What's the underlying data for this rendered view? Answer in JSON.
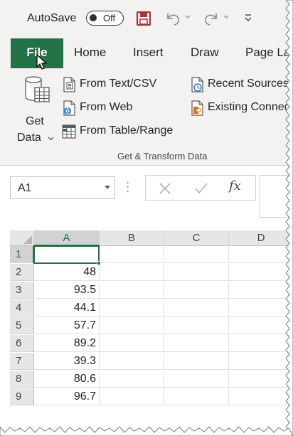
{
  "titlebar": {
    "autosave_label": "AutoSave",
    "autosave_state": "Off"
  },
  "tabs": [
    {
      "label": "File"
    },
    {
      "label": "Home"
    },
    {
      "label": "Insert"
    },
    {
      "label": "Draw"
    },
    {
      "label": "Page La"
    }
  ],
  "ribbon": {
    "get_data_line1": "Get",
    "get_data_line2": "Data",
    "buttons": [
      {
        "label": "From Text/CSV",
        "icon": "text-file-icon"
      },
      {
        "label": "From Web",
        "icon": "web-page-icon"
      },
      {
        "label": "From Table/Range",
        "icon": "table-icon"
      },
      {
        "label": "Recent Sources",
        "icon": "recent-sources-icon"
      },
      {
        "label": "Existing Connec",
        "icon": "existing-connections-icon"
      }
    ],
    "group_label": "Get & Transform Data"
  },
  "formula_bar": {
    "name_box": "A1",
    "fx": "fx"
  },
  "sheet": {
    "columns": [
      "A",
      "B",
      "C",
      "D"
    ],
    "rows": [
      {
        "num": "1",
        "a": ""
      },
      {
        "num": "2",
        "a": "48"
      },
      {
        "num": "3",
        "a": "93.5"
      },
      {
        "num": "4",
        "a": "44.1"
      },
      {
        "num": "5",
        "a": "57.7"
      },
      {
        "num": "6",
        "a": "89.2"
      },
      {
        "num": "7",
        "a": "39.3"
      },
      {
        "num": "8",
        "a": "80.6"
      },
      {
        "num": "9",
        "a": "96.7"
      }
    ],
    "active_cell": "A1"
  },
  "colors": {
    "accent": "#217346",
    "save_icon": "#a4373a"
  }
}
